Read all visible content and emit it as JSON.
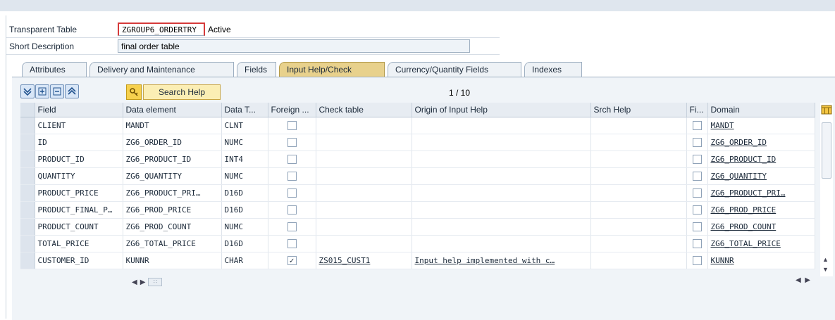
{
  "header": {
    "table_label": "Transparent Table",
    "table_name": "ZGROUP6_ORDERTRY",
    "status": "Active",
    "short_desc_label": "Short Description",
    "short_desc": "final order table"
  },
  "tabs": [
    {
      "label": "Attributes",
      "active": false
    },
    {
      "label": "Delivery and Maintenance",
      "active": false
    },
    {
      "label": "Fields",
      "active": false
    },
    {
      "label": "Input Help/Check",
      "active": true
    },
    {
      "label": "Currency/Quantity Fields",
      "active": false
    },
    {
      "label": "Indexes",
      "active": false
    }
  ],
  "toolbar": {
    "search_help_label": "Search Help",
    "pager": "1 / 10"
  },
  "table": {
    "columns": [
      "Field",
      "Data element",
      "Data T...",
      "Foreign ...",
      "Check table",
      "Origin of Input Help",
      "Srch Help",
      "Fi...",
      "Domain"
    ],
    "rows": [
      {
        "field": "CLIENT",
        "data_element": "MANDT",
        "data_type": "CLNT",
        "foreign": false,
        "check_table": "",
        "origin": "",
        "srch_help": "",
        "fi": false,
        "domain": "MANDT"
      },
      {
        "field": "ID",
        "data_element": "ZG6_ORDER_ID",
        "data_type": "NUMC",
        "foreign": false,
        "check_table": "",
        "origin": "",
        "srch_help": "",
        "fi": false,
        "domain": "ZG6_ORDER_ID"
      },
      {
        "field": "PRODUCT_ID",
        "data_element": "ZG6_PRODUCT_ID",
        "data_type": "INT4",
        "foreign": false,
        "check_table": "",
        "origin": "",
        "srch_help": "",
        "fi": false,
        "domain": "ZG6_PRODUCT_ID"
      },
      {
        "field": "QUANTITY",
        "data_element": "ZG6_QUANTITY",
        "data_type": "NUMC",
        "foreign": false,
        "check_table": "",
        "origin": "",
        "srch_help": "",
        "fi": false,
        "domain": "ZG6_QUANTITY"
      },
      {
        "field": "PRODUCT_PRICE",
        "data_element": "ZG6_PRODUCT_PRI…",
        "data_type": "D16D",
        "foreign": false,
        "check_table": "",
        "origin": "",
        "srch_help": "",
        "fi": false,
        "domain": "ZG6_PRODUCT_PRI…"
      },
      {
        "field": "PRODUCT_FINAL_P…",
        "data_element": "ZG6_PROD_PRICE",
        "data_type": "D16D",
        "foreign": false,
        "check_table": "",
        "origin": "",
        "srch_help": "",
        "fi": false,
        "domain": "ZG6_PROD_PRICE"
      },
      {
        "field": "PRODUCT_COUNT",
        "data_element": "ZG6_PROD_COUNT",
        "data_type": "NUMC",
        "foreign": false,
        "check_table": "",
        "origin": "",
        "srch_help": "",
        "fi": false,
        "domain": "ZG6_PROD_COUNT"
      },
      {
        "field": "TOTAL_PRICE",
        "data_element": "ZG6_TOTAL_PRICE",
        "data_type": "D16D",
        "foreign": false,
        "check_table": "",
        "origin": "",
        "srch_help": "",
        "fi": false,
        "domain": "ZG6_TOTAL_PRICE"
      },
      {
        "field": "CUSTOMER_ID",
        "data_element": "KUNNR",
        "data_type": "CHAR",
        "foreign": true,
        "check_table": "ZS015_CUST1",
        "origin": "Input help implemented with c…",
        "srch_help": "",
        "fi": false,
        "domain": "KUNNR"
      }
    ]
  },
  "colors": {
    "active_tab": "#e8d18c",
    "content_bg": "#f0f4f8",
    "search_help_bg": "#fbeeb4"
  },
  "icons": {
    "toolbar": [
      "select-all-icon",
      "insert-row-icon",
      "delete-row-icon",
      "deselect-icon"
    ],
    "search_help": "search-help-key-icon",
    "column_config": "table-settings-icon"
  }
}
